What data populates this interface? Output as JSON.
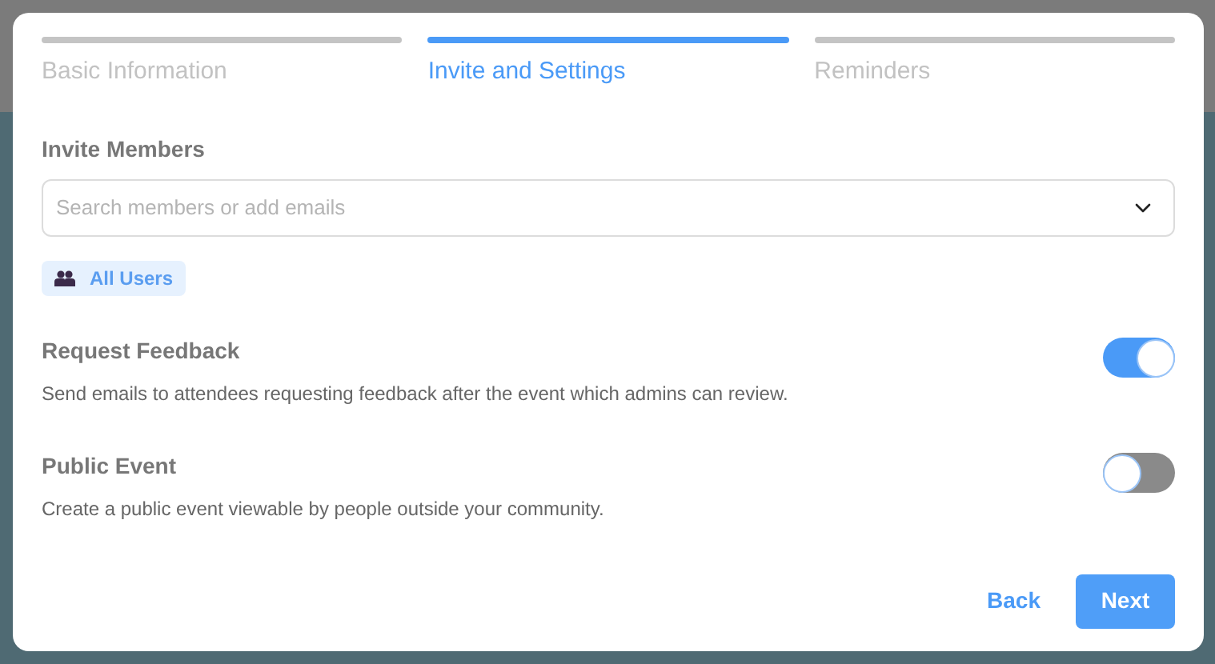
{
  "steps": [
    {
      "label": "Basic Information",
      "selected": false
    },
    {
      "label": "Invite and Settings",
      "selected": true
    },
    {
      "label": "Reminders",
      "selected": false
    }
  ],
  "invite": {
    "label": "Invite Members",
    "placeholder": "Search members or add emails",
    "chips": [
      {
        "label": "All Users"
      }
    ]
  },
  "settings": [
    {
      "title": "Request Feedback",
      "description": "Send emails to attendees requesting feedback after the event which admins can review.",
      "on": true
    },
    {
      "title": "Public Event",
      "description": "Create a public event viewable by people outside your community.",
      "on": false
    }
  ],
  "buttons": {
    "back": "Back",
    "next": "Next"
  }
}
